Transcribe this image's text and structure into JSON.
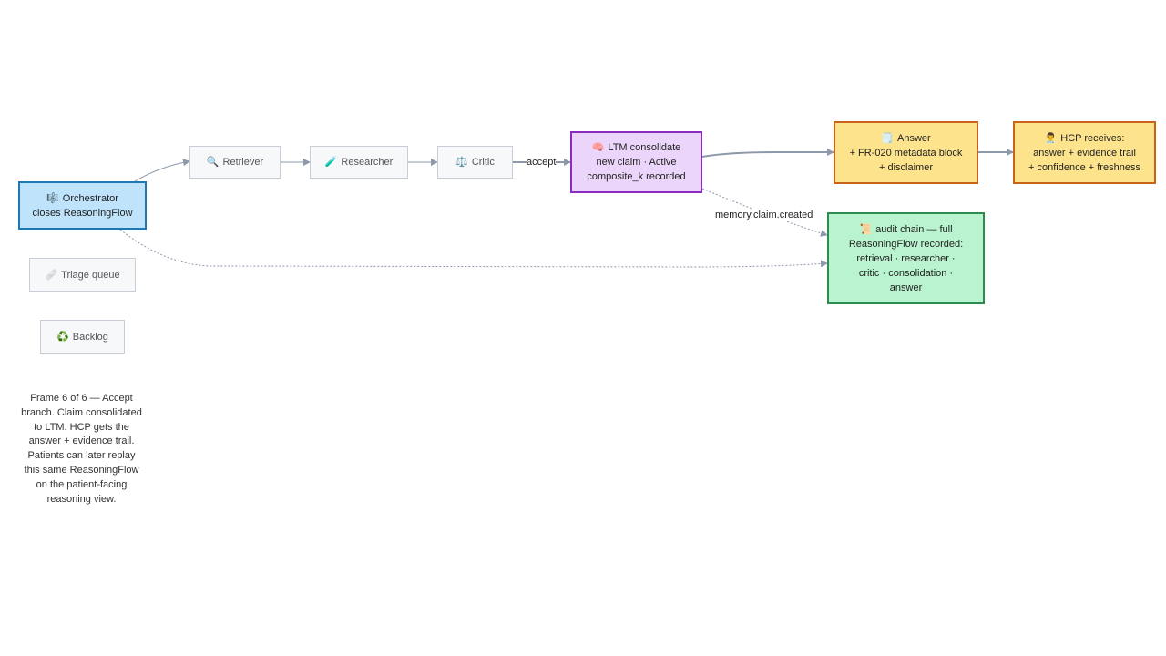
{
  "colors": {
    "edge": "#8d99ab",
    "orchestrator_fill": "#bfe3fb",
    "orchestrator_border": "#1f78b4",
    "ltm_fill": "#ecd5fb",
    "ltm_border": "#8a2cc2",
    "answer_fill": "#fde48c",
    "answer_border": "#c8651a",
    "audit_fill": "#baf3cf",
    "audit_border": "#2e8b4e",
    "inactive_fill": "#f6f8fa",
    "inactive_border": "#c9ced6"
  },
  "nodes": {
    "orchestrator": {
      "icon": "🎼",
      "icon_name": "conductor-icon",
      "lines": [
        "Orchestrator",
        "closes ReasoningFlow"
      ]
    },
    "retriever": {
      "icon": "🔍",
      "icon_name": "magnifier-icon",
      "lines": [
        "Retriever"
      ]
    },
    "researcher": {
      "icon": "🧪",
      "icon_name": "test-tube-icon",
      "lines": [
        "Researcher"
      ]
    },
    "critic": {
      "icon": "⚖️",
      "icon_name": "scales-icon",
      "lines": [
        "Critic"
      ]
    },
    "ltm": {
      "icon": "🧠",
      "icon_name": "brain-icon",
      "lines": [
        "LTM consolidate",
        "new claim · Active",
        "composite_k recorded"
      ]
    },
    "answer": {
      "icon": "🗒️",
      "icon_name": "notepad-icon",
      "lines": [
        "Answer",
        "+ FR-020 metadata block",
        "+ disclaimer"
      ]
    },
    "hcp": {
      "icon": "👨‍⚕️",
      "icon_name": "health-worker-icon",
      "lines": [
        "HCP receives:",
        "answer + evidence trail",
        "+ confidence + freshness"
      ]
    },
    "audit": {
      "icon": "📜",
      "icon_name": "scroll-icon",
      "lines": [
        "audit chain — full",
        "ReasoningFlow recorded:",
        "retrieval · researcher ·",
        "critic · consolidation ·",
        "answer"
      ]
    },
    "triage": {
      "icon": "🩹",
      "icon_name": "bandage-icon",
      "lines": [
        "Triage queue"
      ]
    },
    "backlog": {
      "icon": "♻️",
      "icon_name": "recycle-icon",
      "lines": [
        "Backlog"
      ]
    }
  },
  "edge_labels": {
    "accept": "accept",
    "memory": "memory.claim.created"
  },
  "caption": "Frame 6 of 6 — Accept branch. Claim consolidated to LTM. HCP gets the answer + evidence trail. Patients can later replay this same ReasoningFlow on the patient-facing reasoning view."
}
